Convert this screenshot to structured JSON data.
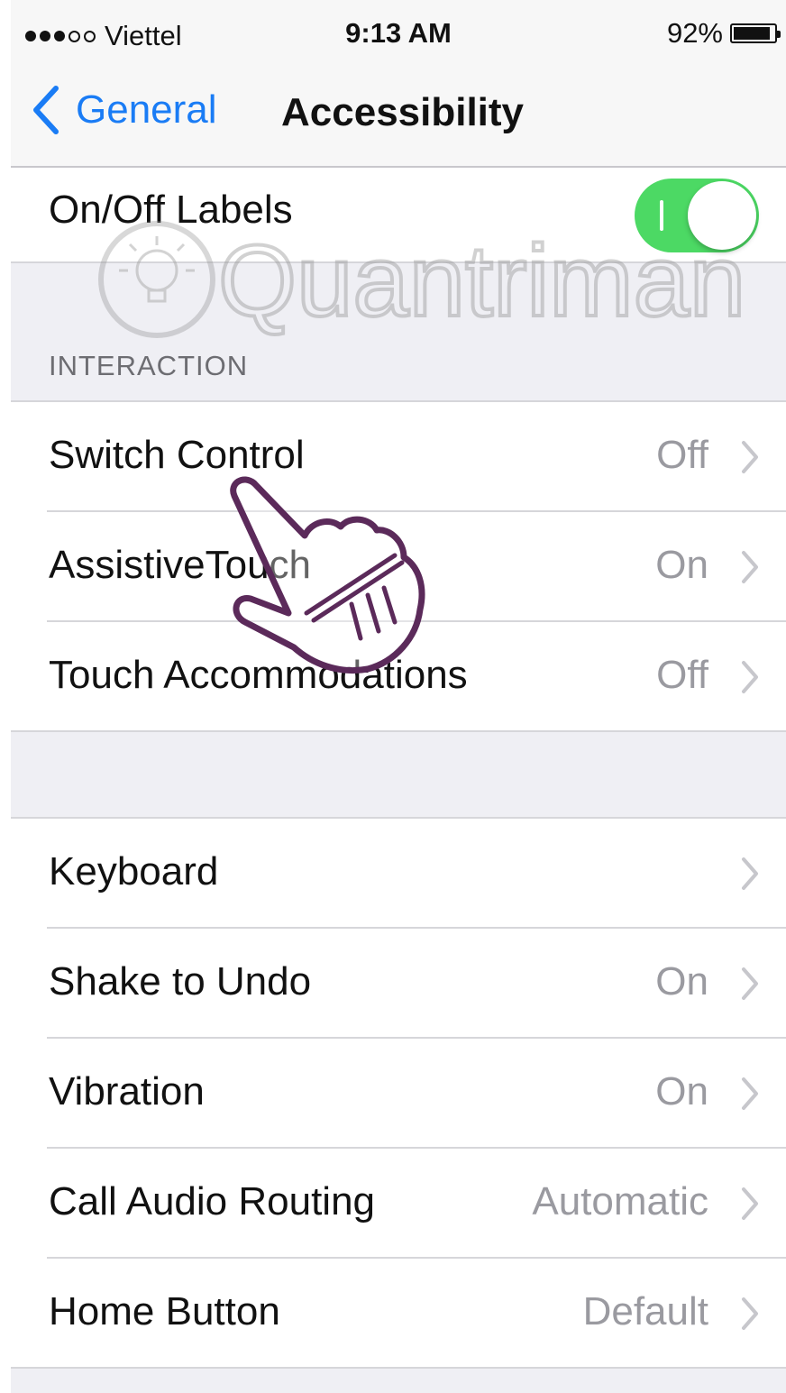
{
  "status_bar": {
    "carrier": "Viettel",
    "time": "9:13 AM",
    "battery_percent": "92%",
    "signal_bars_filled": 3,
    "signal_bars_total": 5
  },
  "nav": {
    "back_label": "General",
    "title": "Accessibility"
  },
  "top_cell": {
    "label": "On/Off Labels",
    "toggle_on": true,
    "toggle_color": "#4cd964"
  },
  "interaction": {
    "header": "INTERACTION",
    "items": [
      {
        "label": "Switch Control",
        "value": "Off"
      },
      {
        "label": "AssistiveTouch",
        "value": "On"
      },
      {
        "label": "Touch Accommodations",
        "value": "Off"
      }
    ]
  },
  "general_items": [
    {
      "label": "Keyboard",
      "value": ""
    },
    {
      "label": "Shake to Undo",
      "value": "On"
    },
    {
      "label": "Vibration",
      "value": "On"
    },
    {
      "label": "Call Audio Routing",
      "value": "Automatic"
    },
    {
      "label": "Home Button",
      "value": "Default"
    }
  ],
  "watermark": {
    "text": "Quantrimang"
  },
  "colors": {
    "accent": "#1a7cf5",
    "secondary_text": "#9a9aa0",
    "group_bg": "#efeff4",
    "hand_outline": "#5b2a5a"
  },
  "icons": [
    "signal-dots-icon",
    "battery-icon",
    "back-chevron-icon",
    "chevron-right-icon",
    "lightbulb-icon",
    "pointing-hand-icon"
  ]
}
